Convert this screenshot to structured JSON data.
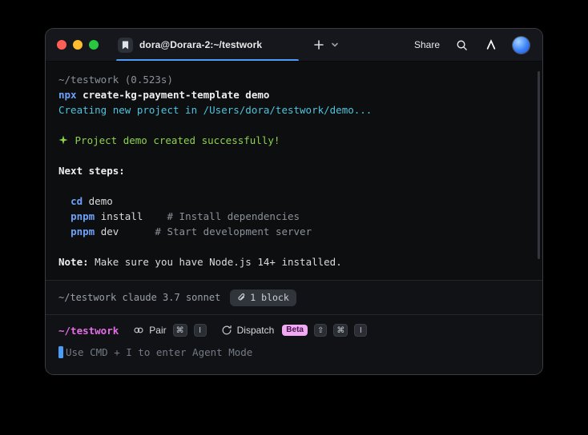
{
  "window": {
    "tab_title": "dora@Dorara-2:~/testwork",
    "share_label": "Share"
  },
  "terminal": {
    "lines": [
      {
        "segments": [
          {
            "text": "~/testwork (0.523s)",
            "style": "muted"
          }
        ]
      },
      {
        "segments": [
          {
            "text": "npx",
            "style": "cmd"
          },
          {
            "text": " create-kg-payment-template demo",
            "style": "bold"
          }
        ]
      },
      {
        "segments": [
          {
            "text": "Creating new project in /Users/dora/testwork/demo...",
            "style": "cyan"
          }
        ]
      },
      {
        "segments": []
      },
      {
        "segments": [
          {
            "icon": "sparkle-icon",
            "style": "green"
          },
          {
            "text": " Project demo created successfully!",
            "style": "green"
          }
        ]
      },
      {
        "segments": []
      },
      {
        "segments": [
          {
            "text": "Next steps:",
            "style": "bold"
          }
        ]
      },
      {
        "segments": []
      },
      {
        "segments": [
          {
            "text": "  ",
            "style": "white"
          },
          {
            "text": "cd",
            "style": "cmd"
          },
          {
            "text": " demo",
            "style": "white"
          }
        ]
      },
      {
        "segments": [
          {
            "text": "  ",
            "style": "white"
          },
          {
            "text": "pnpm",
            "style": "cmd"
          },
          {
            "text": " install",
            "style": "white"
          },
          {
            "text": "    # Install dependencies",
            "style": "comment"
          }
        ]
      },
      {
        "segments": [
          {
            "text": "  ",
            "style": "white"
          },
          {
            "text": "pnpm",
            "style": "cmd"
          },
          {
            "text": " dev",
            "style": "white"
          },
          {
            "text": "      # Start development server",
            "style": "comment"
          }
        ]
      },
      {
        "segments": []
      },
      {
        "segments": [
          {
            "text": "Note:",
            "style": "bold"
          },
          {
            "text": " Make sure you have Node.js 14+ installed.",
            "style": "white"
          }
        ]
      }
    ]
  },
  "status_bar": {
    "context": "~/testwork claude 3.7 sonnet",
    "block_badge_label": "1 block"
  },
  "input": {
    "prompt": "~/testwork",
    "pair": {
      "label": "Pair",
      "keys": [
        "⌘",
        "I"
      ]
    },
    "dispatch": {
      "label": "Dispatch",
      "badge": "Beta",
      "keys": [
        "⇧",
        "⌘",
        "I"
      ]
    },
    "placeholder": "Use CMD + I to enter Agent Mode"
  },
  "colors": {
    "accent_blue": "#4b9df8",
    "prompt_magenta": "#e56de5",
    "beta_pink": "#efaaf2",
    "command_blue": "#6ea1f8",
    "output_cyan": "#4fc3dd",
    "success_green": "#8ed14b",
    "muted_gray": "#8b929a"
  }
}
